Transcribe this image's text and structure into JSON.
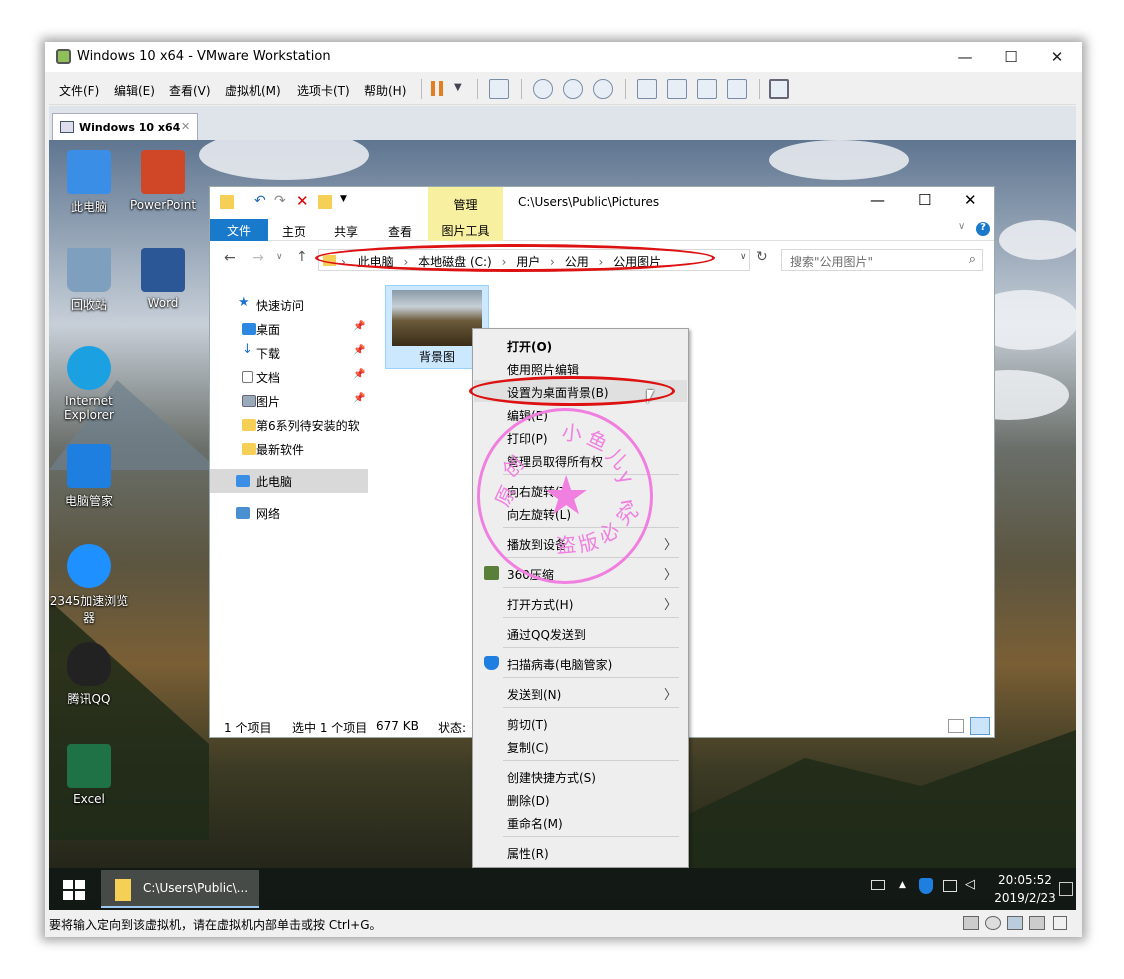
{
  "vm": {
    "title": "Windows 10 x64 - VMware Workstation",
    "controls": {
      "minimize": "—",
      "maximize": "☐",
      "close": "✕"
    },
    "menu": [
      "文件(F)",
      "编辑(E)",
      "查看(V)",
      "虚拟机(M)",
      "选项卡(T)",
      "帮助(H)"
    ],
    "tab_label": "Windows 10 x64",
    "tab_close": "✕",
    "status_text": "要将输入定向到该虚拟机，请在虚拟机内部单击或按 Ctrl+G。"
  },
  "desktop": {
    "icons": [
      {
        "label": "此电脑",
        "color": "#3a8ee6"
      },
      {
        "label": "PowerPoint",
        "color": "#d04727"
      },
      {
        "label": "回收站",
        "color": "#7f9fbf"
      },
      {
        "label": "Word",
        "color": "#2b5797"
      },
      {
        "label": "Internet Explorer",
        "color": "#1ba1e2"
      },
      {
        "label": "电脑管家",
        "color": "#1e7fe0"
      },
      {
        "label": "2345加速浏览器",
        "color": "#1e90ff"
      },
      {
        "label": "腾讯QQ",
        "color": "#222222"
      },
      {
        "label": "Excel",
        "color": "#1f7246"
      }
    ]
  },
  "explorer": {
    "context_tab": "管理",
    "path_title": "C:\\Users\\Public\\Pictures",
    "ribbon_tabs": [
      "文件",
      "主页",
      "共享",
      "查看",
      "图片工具"
    ],
    "breadcrumb": [
      "此电脑",
      "本地磁盘 (C:)",
      "用户",
      "公用",
      "公用图片"
    ],
    "search_placeholder": "搜索\"公用图片\"",
    "nav": {
      "quick_access": "快速访问",
      "items": [
        "桌面",
        "下载",
        "文档",
        "图片",
        "第6系列待安装的软",
        "最新软件"
      ],
      "this_pc": "此电脑",
      "network": "网络"
    },
    "file": {
      "name": "背景图"
    },
    "status": {
      "count": "1 个项目",
      "selected": "选中 1 个项目",
      "size": "677 KB",
      "state": "状态:"
    }
  },
  "context_menu": {
    "items": [
      {
        "label": "打开(O)",
        "bold": true
      },
      {
        "label": "使用照片编辑"
      },
      {
        "label": "设置为桌面背景(B)"
      },
      {
        "label": "编辑(E)"
      },
      {
        "label": "打印(P)"
      },
      {
        "label": "管理员取得所有权"
      },
      {
        "label": "向右旋转(T)"
      },
      {
        "label": "向左旋转(L)"
      },
      {
        "label": "播放到设备"
      },
      {
        "label": "360压缩"
      },
      {
        "label": "打开方式(H)"
      },
      {
        "label": "通过QQ发送到"
      },
      {
        "label": "扫描病毒(电脑管家)"
      },
      {
        "label": "发送到(N)"
      },
      {
        "label": "剪切(T)"
      },
      {
        "label": "复制(C)"
      },
      {
        "label": "创建快捷方式(S)"
      },
      {
        "label": "删除(D)"
      },
      {
        "label": "重命名(M)"
      },
      {
        "label": "属性(R)"
      }
    ],
    "submenu_arrow": "〉"
  },
  "watermark": {
    "chars": [
      "原",
      "创",
      "小",
      "鱼",
      "儿",
      "y",
      "r",
      "盗",
      "版",
      "必",
      "究"
    ],
    "star": "★",
    "color": "#f07fe0"
  },
  "taskbar": {
    "task_label": "C:\\Users\\Public\\...",
    "time": "20:05:52",
    "date": "2019/2/23"
  },
  "highlight_color": "#dd1111"
}
